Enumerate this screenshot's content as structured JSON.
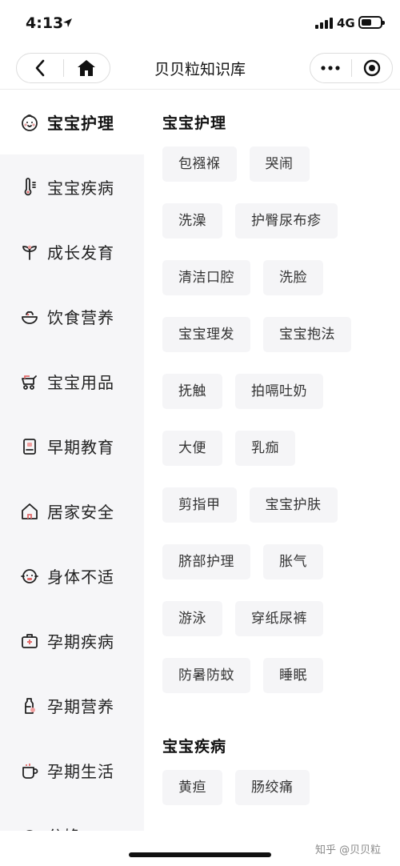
{
  "status_bar": {
    "time": "4:13",
    "network": "4G",
    "battery_level": 0.55
  },
  "navbar": {
    "title": "贝贝粒知识库"
  },
  "sidebar": {
    "items": [
      {
        "label": "宝宝护理",
        "icon": "baby-face-icon",
        "active": true
      },
      {
        "label": "宝宝疾病",
        "icon": "thermometer-icon",
        "active": false
      },
      {
        "label": "成长发育",
        "icon": "sprout-icon",
        "active": false
      },
      {
        "label": "饮食营养",
        "icon": "food-bowl-icon",
        "active": false
      },
      {
        "label": "宝宝用品",
        "icon": "stroller-icon",
        "active": false
      },
      {
        "label": "早期教育",
        "icon": "book-icon",
        "active": false
      },
      {
        "label": "居家安全",
        "icon": "house-icon",
        "active": false
      },
      {
        "label": "身体不适",
        "icon": "sick-face-icon",
        "active": false
      },
      {
        "label": "孕期疾病",
        "icon": "medical-kit-icon",
        "active": false
      },
      {
        "label": "孕期营养",
        "icon": "milk-bottle-icon",
        "active": false
      },
      {
        "label": "孕期生活",
        "icon": "cup-icon",
        "active": false
      },
      {
        "label": "分娩",
        "icon": "cutoff-icon",
        "active": false
      }
    ]
  },
  "content": {
    "sections": [
      {
        "title": "宝宝护理",
        "tags": [
          "包襁褓",
          "哭闹",
          "洗澡",
          "护臀尿布疹",
          "清洁口腔",
          "洗脸",
          "宝宝理发",
          "宝宝抱法",
          "抚触",
          "拍嗝吐奶",
          "大便",
          "乳痂",
          "剪指甲",
          "宝宝护肤",
          "脐部护理",
          "胀气",
          "游泳",
          "穿纸尿裤",
          "防暑防蚊",
          "睡眠"
        ]
      },
      {
        "title": "宝宝疾病",
        "tags": [
          "黄疸",
          "肠绞痛"
        ]
      }
    ]
  },
  "watermark": "知乎 @贝贝粒"
}
